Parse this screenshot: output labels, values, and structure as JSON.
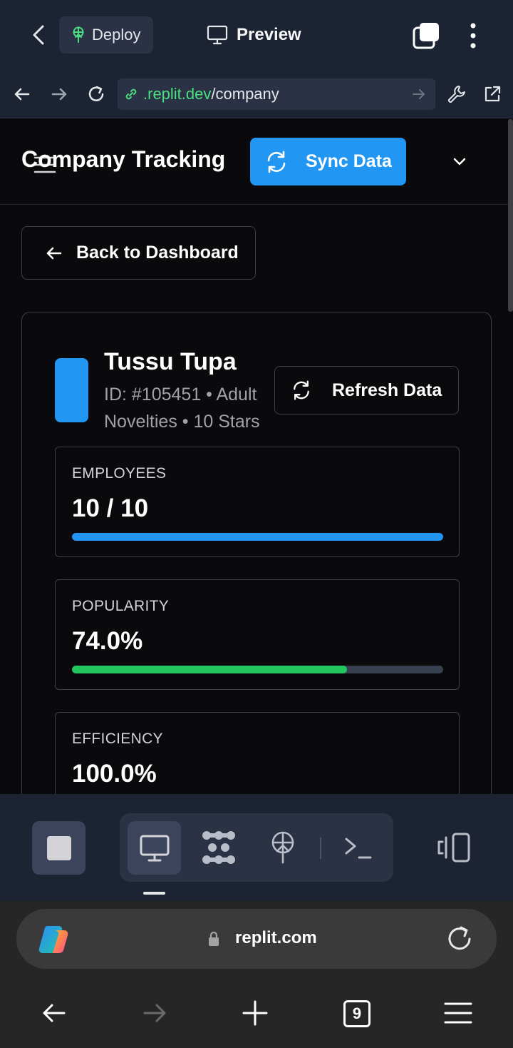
{
  "topbar": {
    "deploy_label": "Deploy",
    "preview_label": "Preview"
  },
  "urlbar": {
    "host": ".replit.dev",
    "path": "/company"
  },
  "app": {
    "title": "Company Tracking",
    "sync_label": "Sync Data",
    "back_label": "Back to Dashboard"
  },
  "company": {
    "name": "Tussu Tupa",
    "meta": "ID: #105451 • Adult Novelties • 10 Stars",
    "refresh_label": "Refresh Data",
    "avatar_color": "#2196f3",
    "stats": [
      {
        "label": "EMPLOYEES",
        "value": "10 / 10",
        "progress": 1.0,
        "color": "#2196f3"
      },
      {
        "label": "POPULARITY",
        "value": "74.0%",
        "progress": 0.74,
        "color": "#22c55e"
      },
      {
        "label": "EFFICIENCY",
        "value": "100.0%",
        "progress": 1.0,
        "color": "#22c55e"
      }
    ]
  },
  "browser": {
    "domain": "replit.com",
    "tab_count": "9"
  },
  "icons": {
    "deploy": "deploy-icon",
    "preview": "monitor-icon",
    "sync": "refresh-icon",
    "copilot": "copilot-icon"
  }
}
